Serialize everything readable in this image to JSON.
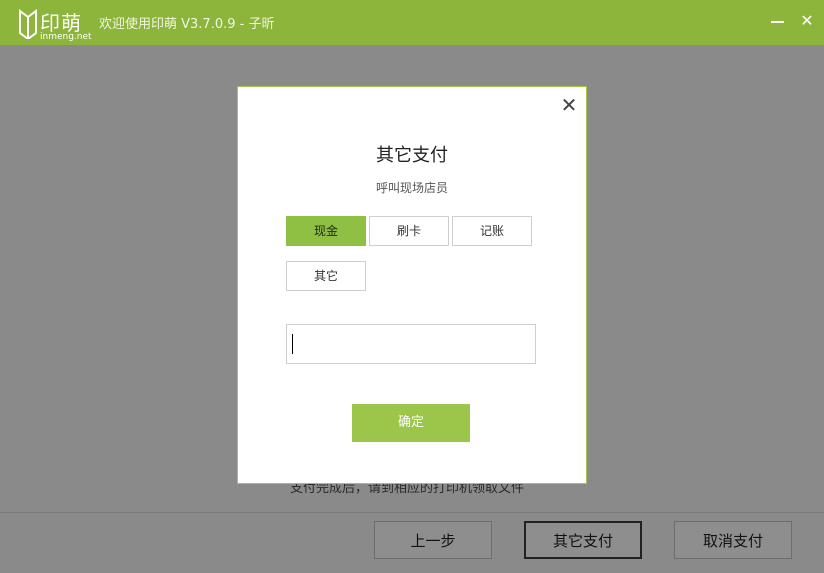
{
  "app": {
    "logo_cn": "印萌",
    "logo_en": "inmeng.net",
    "title": "欢迎使用印萌 V3.7.0.9 - 子昕"
  },
  "window": {
    "minimize_icon": "minimize-icon",
    "close_icon": "close-icon"
  },
  "background": {
    "instruction_text": "支付完成后，请到相应的打印机领取文件"
  },
  "footer": {
    "back_label": "上一步",
    "other_pay_label": "其它支付",
    "cancel_label": "取消支付"
  },
  "modal": {
    "title": "其它支付",
    "subtitle": "呼叫现场店员",
    "options": [
      {
        "label": "现金",
        "selected": true
      },
      {
        "label": "刷卡",
        "selected": false
      },
      {
        "label": "记账",
        "selected": false
      },
      {
        "label": "其它",
        "selected": false
      }
    ],
    "input_value": "",
    "confirm_label": "确定",
    "close_icon": "close-icon"
  },
  "colors": {
    "accent": "#8db53c",
    "selected": "#8fc043",
    "confirm": "#9cc64a",
    "overlay": "#8a8a8a"
  }
}
